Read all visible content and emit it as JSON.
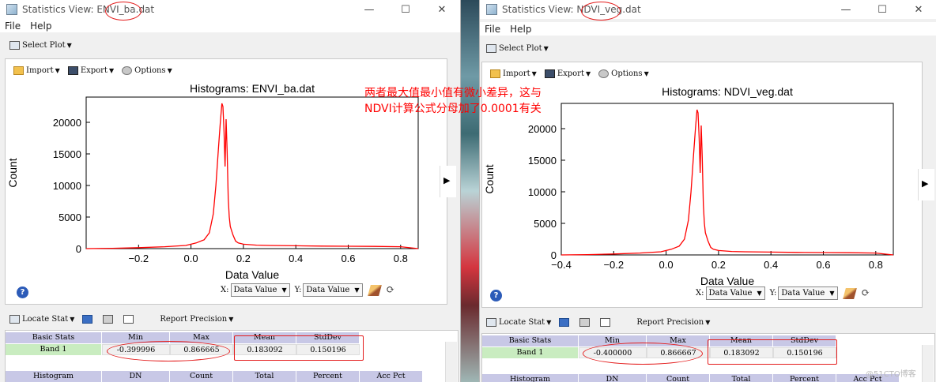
{
  "windows": [
    {
      "title": "Statistics View: ENVI_ba.dat",
      "menu": [
        "File",
        "Help"
      ],
      "select_plot": "Select Plot",
      "plot_toolbar": [
        "Import",
        "Export",
        "Options"
      ],
      "plot_title": "Histograms: ENVI_ba.dat",
      "x_axis_select_label": "X:",
      "y_axis_select_label": "Y:",
      "x_axis_value": "Data Value",
      "y_axis_value": "Data Value",
      "stats_toolbar": {
        "locate_stat": "Locate Stat",
        "report_precision": "Report Precision"
      },
      "basic_stats": {
        "headers": [
          "Basic Stats",
          "Min",
          "Max",
          "Mean",
          "StdDev"
        ],
        "rows": [
          [
            "Band 1",
            "-0.399996",
            "0.866665",
            "0.183092",
            "0.150196"
          ]
        ]
      },
      "histogram_headers": [
        "Histogram",
        "DN",
        "Count",
        "Total",
        "Percent",
        "Acc Pct"
      ]
    },
    {
      "title": "Statistics View: NDVI_veg.dat",
      "menu": [
        "File",
        "Help"
      ],
      "select_plot": "Select Plot",
      "plot_toolbar": [
        "Import",
        "Export",
        "Options"
      ],
      "plot_title": "Histograms: NDVI_veg.dat",
      "x_axis_select_label": "X:",
      "y_axis_select_label": "Y:",
      "x_axis_value": "Data Value",
      "y_axis_value": "Data Value",
      "stats_toolbar": {
        "locate_stat": "Locate Stat",
        "report_precision": "Report Precision"
      },
      "basic_stats": {
        "headers": [
          "Basic Stats",
          "Min",
          "Max",
          "Mean",
          "StdDev"
        ],
        "rows": [
          [
            "Band 1",
            "-0.400000",
            "0.866667",
            "0.183092",
            "0.150196"
          ]
        ]
      },
      "histogram_headers": [
        "Histogram",
        "DN",
        "Count",
        "Total",
        "Percent",
        "Acc Pct"
      ]
    }
  ],
  "annotation": {
    "line1": "两者最大值最小值有微小差异，这与",
    "line2": "NDVI计算公式分母加了0.0001有关",
    "color": "#ff0000"
  },
  "watermark": "@51CTO博客",
  "chart_data": [
    {
      "type": "line",
      "title": "Histograms: ENVI_ba.dat",
      "xlabel": "Data Value",
      "ylabel": "Count",
      "xlim": [
        -0.4,
        0.867
      ],
      "ylim": [
        0,
        24000
      ],
      "xticks": [
        -0.2,
        0.0,
        0.2,
        0.4,
        0.6,
        0.8
      ],
      "yticks": [
        0,
        5000,
        10000,
        15000,
        20000
      ],
      "color": "#ff0000",
      "series": [
        {
          "x": [
            -0.4,
            -0.3,
            -0.2,
            -0.1,
            -0.02,
            0.02,
            0.05,
            0.07,
            0.085,
            0.095,
            0.105,
            0.112,
            0.118,
            0.122,
            0.126,
            0.13,
            0.134,
            0.138,
            0.142,
            0.146,
            0.15,
            0.16,
            0.17,
            0.18,
            0.2,
            0.25,
            0.3,
            0.4,
            0.5,
            0.6,
            0.7,
            0.8,
            0.867
          ],
          "y": [
            0,
            50,
            150,
            300,
            500,
            900,
            1400,
            2500,
            5500,
            10000,
            16000,
            20000,
            23000,
            22500,
            18500,
            13000,
            20500,
            15500,
            8000,
            5000,
            3500,
            2200,
            1200,
            900,
            700,
            550,
            500,
            450,
            400,
            380,
            350,
            300,
            0
          ]
        }
      ]
    },
    {
      "type": "line",
      "title": "Histograms: NDVI_veg.dat",
      "xlabel": "Data Value",
      "ylabel": "Count",
      "xlim": [
        -0.4,
        0.867
      ],
      "ylim": [
        0,
        24000
      ],
      "xticks": [
        -0.4,
        -0.2,
        0.0,
        0.2,
        0.4,
        0.6,
        0.8
      ],
      "yticks": [
        0,
        5000,
        10000,
        15000,
        20000
      ],
      "color": "#ff0000",
      "series": [
        {
          "x": [
            -0.4,
            -0.3,
            -0.2,
            -0.1,
            -0.02,
            0.02,
            0.05,
            0.07,
            0.085,
            0.095,
            0.105,
            0.112,
            0.118,
            0.122,
            0.126,
            0.13,
            0.134,
            0.138,
            0.142,
            0.146,
            0.15,
            0.16,
            0.17,
            0.18,
            0.2,
            0.25,
            0.3,
            0.4,
            0.5,
            0.6,
            0.7,
            0.8,
            0.867
          ],
          "y": [
            0,
            50,
            150,
            300,
            500,
            900,
            1400,
            2500,
            5500,
            10000,
            16000,
            20000,
            23000,
            22500,
            18500,
            13000,
            20500,
            15500,
            8000,
            5000,
            3500,
            2200,
            1200,
            900,
            700,
            550,
            500,
            450,
            400,
            380,
            350,
            300,
            0
          ]
        }
      ]
    }
  ]
}
